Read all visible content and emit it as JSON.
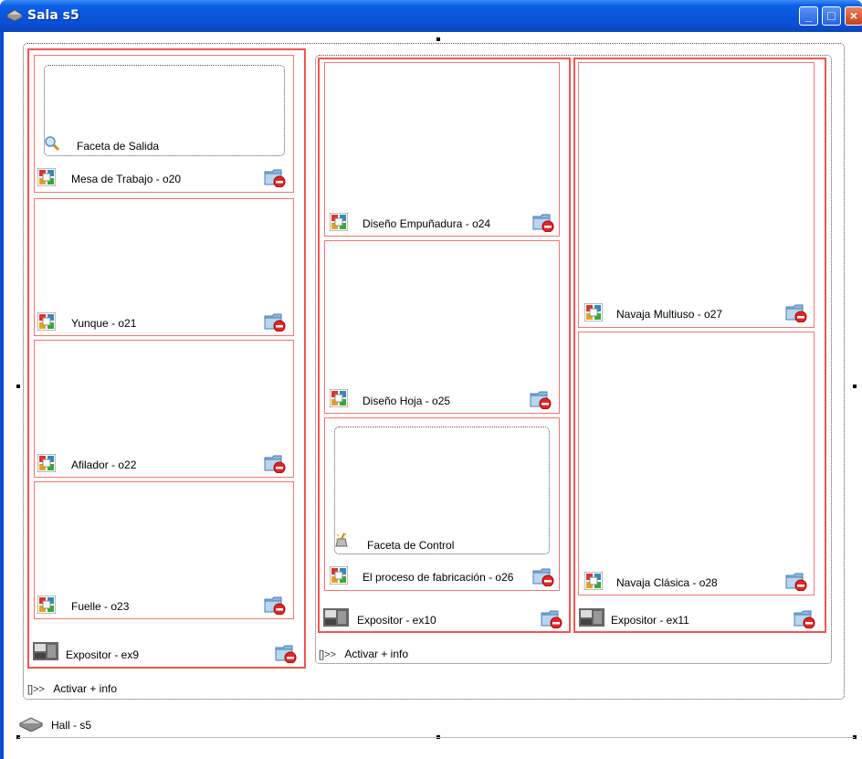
{
  "window": {
    "title": "Sala s5"
  },
  "hall": {
    "label": "Hall - s5"
  },
  "activate_label": "Activar + info",
  "activate_glyph": "[]>>",
  "expositors": {
    "ex9": {
      "label": "Expositor - ex9",
      "objects": [
        {
          "label": "Mesa de Trabajo - o20",
          "facet": "Faceta de Salida"
        },
        {
          "label": "Yunque - o21"
        },
        {
          "label": "Afilador - o22"
        },
        {
          "label": "Fuelle - o23"
        }
      ]
    },
    "ex10": {
      "label": "Expositor - ex10",
      "objects": [
        {
          "label": "Diseño Empuñadura - o24"
        },
        {
          "label": "Diseño Hoja - o25"
        },
        {
          "label": "El proceso de fabricación - o26",
          "facet": "Faceta de Control"
        }
      ]
    },
    "ex11": {
      "label": "Expositor - ex11",
      "objects": [
        {
          "label": "Navaja Multiuso - o27"
        },
        {
          "label": "Navaja Clásica - o28"
        }
      ]
    }
  },
  "colors": {
    "titlebar": "#0a4ccf",
    "object_border": "#ee7777",
    "expositor_border": "#dd4444"
  }
}
